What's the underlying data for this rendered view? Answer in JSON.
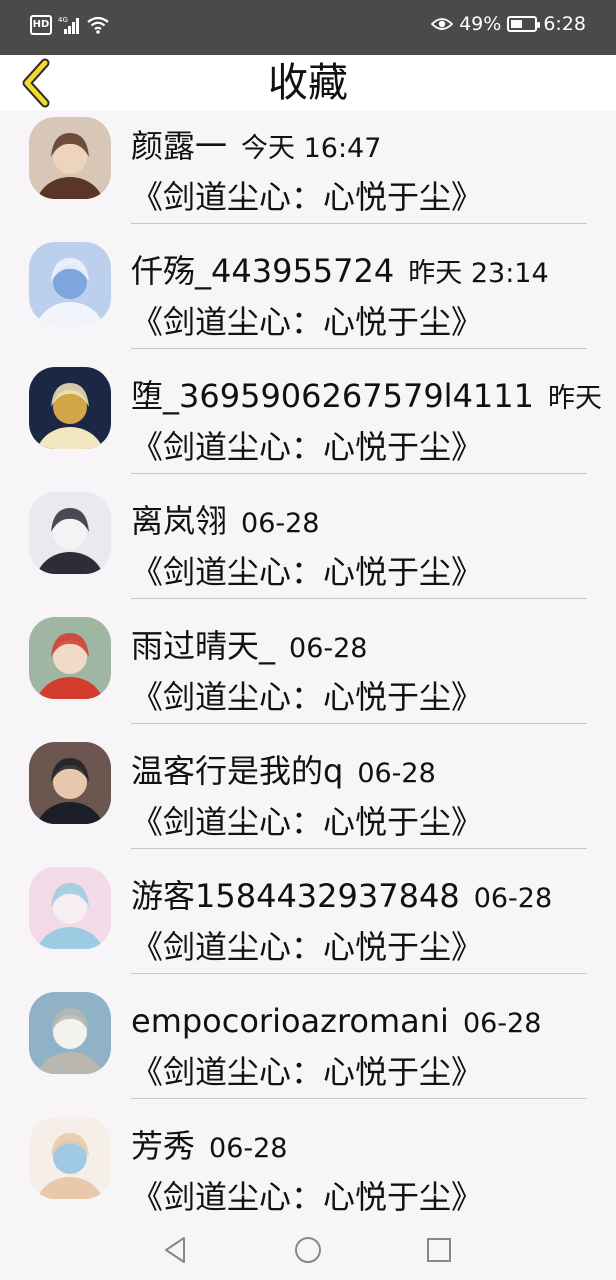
{
  "status_bar": {
    "hd": "HD",
    "network": "4G",
    "battery_pct": "49%",
    "battery_level": 0.49,
    "time": "6:28"
  },
  "header": {
    "title": "收藏"
  },
  "colors": {
    "back_arrow": "#f6d92e",
    "status_bg": "#4a4a4a",
    "page_bg": "#f7f5f7"
  },
  "favorites": [
    {
      "name": "颜露一",
      "time": "今天 16:47",
      "book": "《剑道尘心：心悦于尘》"
    },
    {
      "name": "仟殇_443955724",
      "time": "昨天 23:14",
      "book": "《剑道尘心：心悦于尘》"
    },
    {
      "name": "堕_3695906267579l4111",
      "time": "昨天",
      "book": "《剑道尘心：心悦于尘》"
    },
    {
      "name": "离岚翎",
      "time": "06-28",
      "book": "《剑道尘心：心悦于尘》"
    },
    {
      "name": "雨过晴天_",
      "time": "06-28",
      "book": "《剑道尘心：心悦于尘》"
    },
    {
      "name": "温客行是我的q",
      "time": "06-28",
      "book": "《剑道尘心：心悦于尘》"
    },
    {
      "name": "游客1584432937848",
      "time": "06-28",
      "book": "《剑道尘心：心悦于尘》"
    },
    {
      "name": "empocorioazromani",
      "time": "06-28",
      "book": "《剑道尘心：心悦于尘》"
    },
    {
      "name": "芳秀",
      "time": "06-28",
      "book": "《剑道尘心：心悦于尘》"
    }
  ],
  "nav": {
    "icons": [
      "back-triangle-icon",
      "home-circle-icon",
      "recents-square-icon"
    ]
  }
}
